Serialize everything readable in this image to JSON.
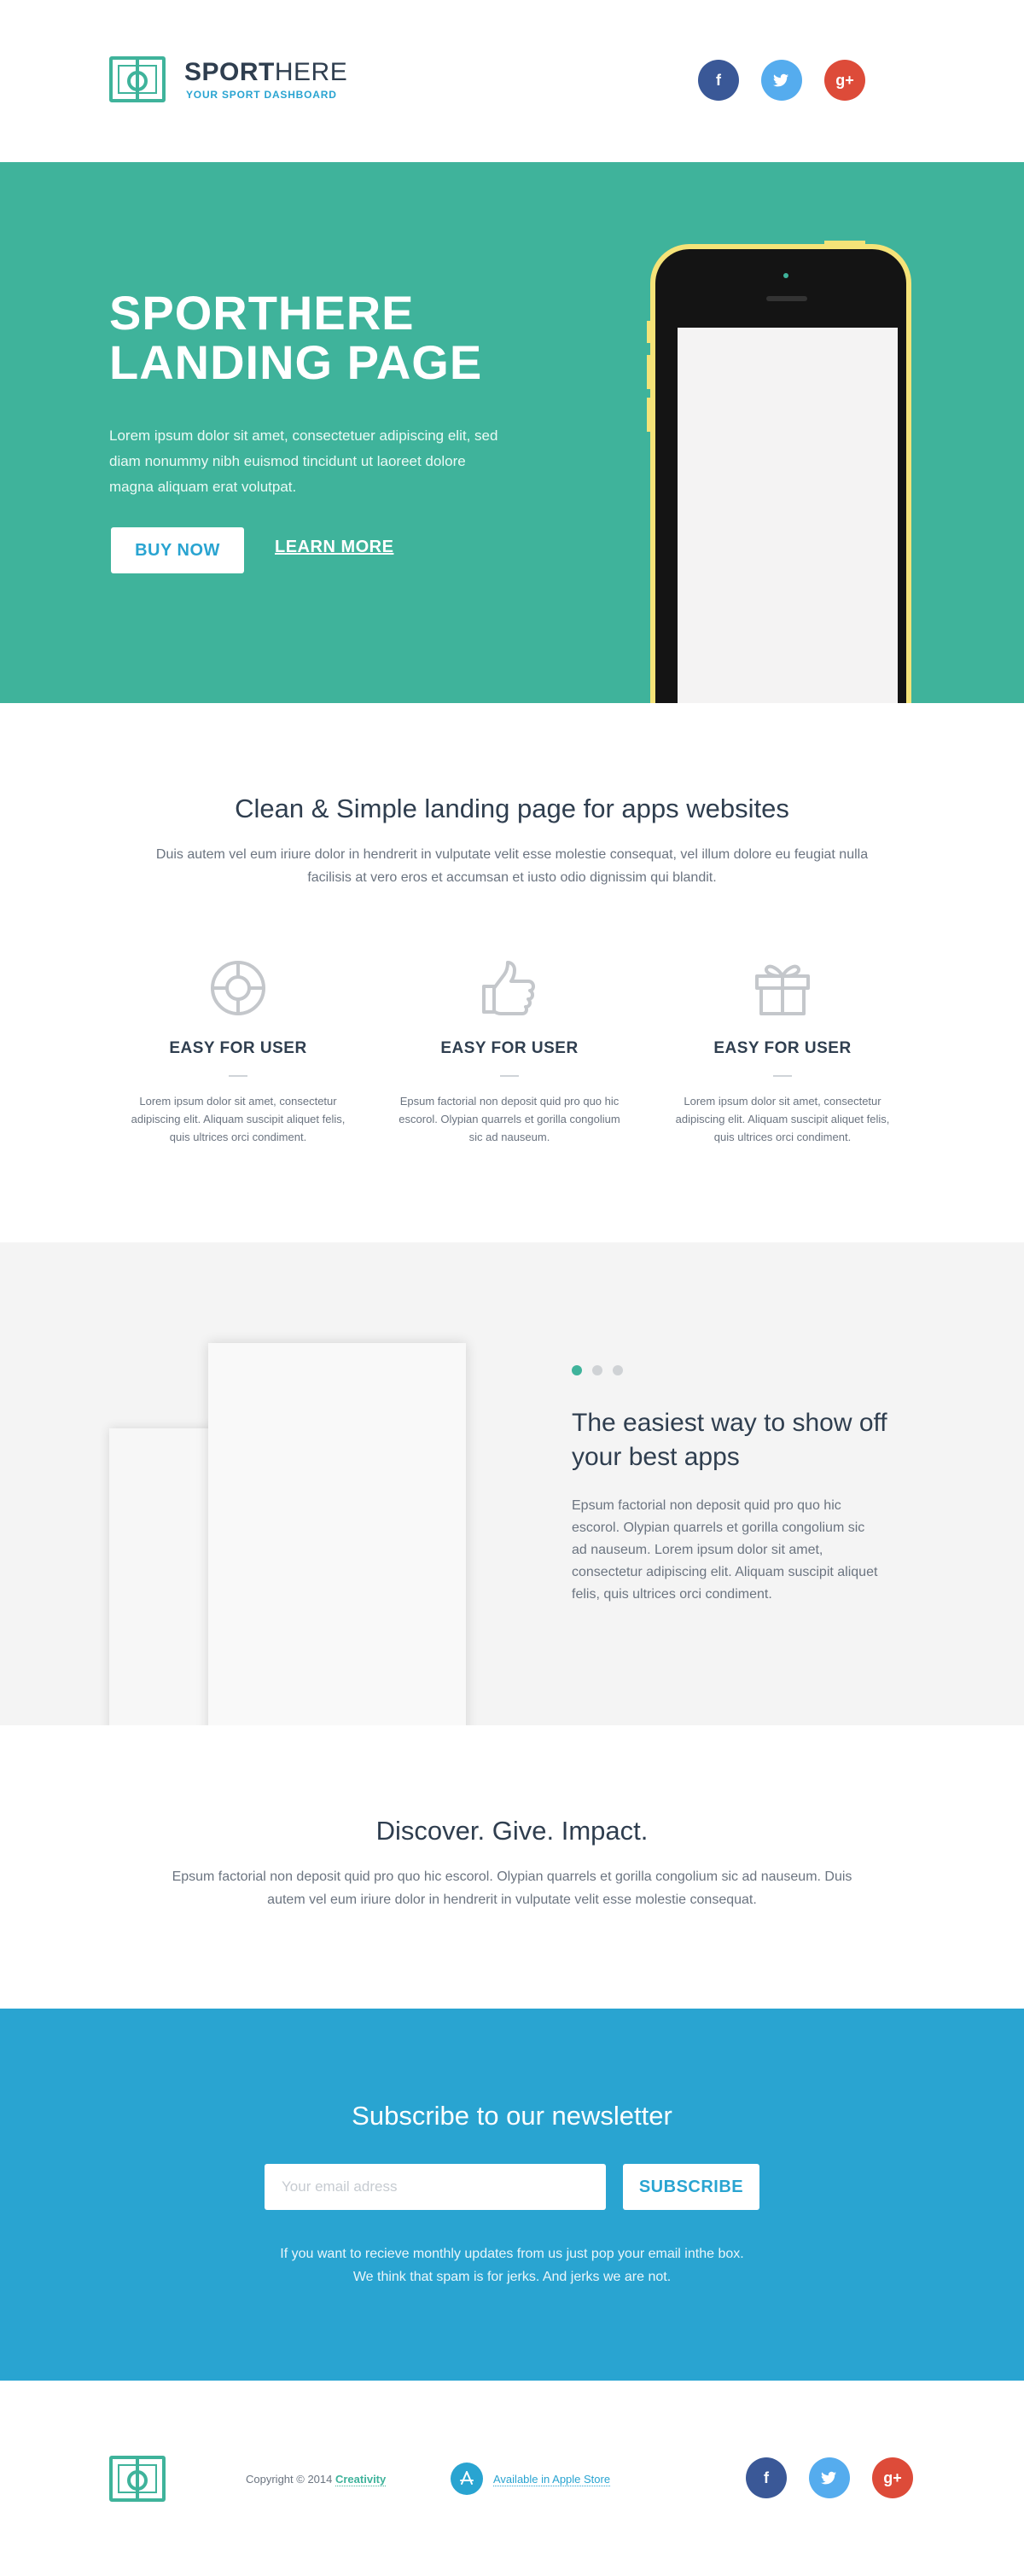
{
  "header": {
    "brand_bold": "SPORT",
    "brand_light": "HERE",
    "tagline": "YOUR SPORT DASHBOARD",
    "social": [
      "f",
      "t",
      "g+"
    ]
  },
  "hero": {
    "title_line1": "SPORTHERE",
    "title_line2": "LANDING PAGE",
    "text": "Lorem ipsum dolor sit amet, consectetuer adipiscing elit, sed diam nonummy nibh euismod tincidunt ut laoreet dolore magna aliquam erat volutpat.",
    "buy_label": "BUY NOW",
    "learn_label": "LEARN MORE"
  },
  "features": {
    "title": "Clean & Simple landing page for apps websites",
    "text": "Duis autem vel eum iriure dolor in hendrerit in vulputate velit esse molestie consequat, vel illum dolore eu feugiat nulla facilisis at vero eros et accumsan et iusto odio dignissim qui blandit.",
    "items": [
      {
        "icon": "lifebuoy-icon",
        "title": "EASY FOR USER",
        "text": "Lorem ipsum dolor sit amet, consectetur adipiscing elit. Aliquam suscipit aliquet felis, quis ultrices orci condiment."
      },
      {
        "icon": "thumbs-up-icon",
        "title": "EASY FOR USER",
        "text": "Epsum factorial non deposit quid pro quo hic escorol. Olypian quarrels et gorilla congolium sic ad nauseum."
      },
      {
        "icon": "gift-icon",
        "title": "EASY FOR USER",
        "text": "Lorem ipsum dolor sit amet, consectetur adipiscing elit. Aliquam suscipit aliquet felis, quis ultrices orci condiment."
      }
    ]
  },
  "showcase": {
    "title": "The easiest way to show off your best apps",
    "text": "Epsum factorial non deposit quid pro quo hic escorol. Olypian quarrels et gorilla congolium sic ad nauseum. Lorem ipsum dolor sit amet, consectetur adipiscing elit. Aliquam suscipit aliquet felis, quis ultrices orci condiment.",
    "active_slide": 1,
    "slide_count": 3
  },
  "discover": {
    "title": "Discover. Give. Impact.",
    "text": "Epsum factorial non deposit quid pro quo hic escorol. Olypian quarrels et gorilla congolium sic ad nauseum. Duis autem vel eum iriure dolor in hendrerit in vulputate velit esse molestie consequat."
  },
  "newsletter": {
    "title": "Subscribe to our newsletter",
    "email_placeholder": "Your email adress",
    "email_value": "",
    "button_label": "SUBSCRIBE",
    "text_line1": "If you want to recieve monthly updates from us just pop your email inthe box.",
    "text_line2": "We think that spam is for jerks. And jerks we are not."
  },
  "footer": {
    "copyright_prefix": "Copyright © 2014",
    "copyright_link": "Creativity",
    "store_label": "Available in Apple Store",
    "social": [
      "f",
      "t",
      "g+"
    ]
  },
  "colors": {
    "green": "#3fb39b",
    "blue": "#29a4d1",
    "dark": "#2f3e4f",
    "facebook": "#3a5897",
    "twitter": "#55acee",
    "google": "#dd4b39",
    "phone_yellow": "#f5e378"
  }
}
